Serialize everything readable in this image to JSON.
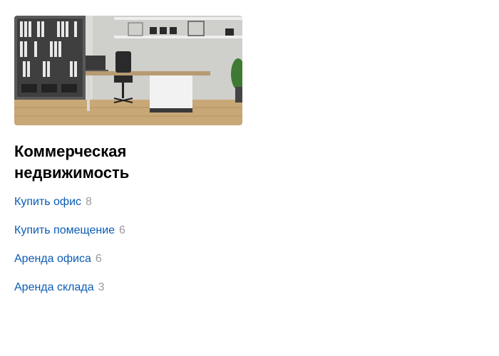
{
  "card": {
    "title": "Коммерческая недвижимость",
    "links": [
      {
        "label": "Купить офис",
        "count": "8"
      },
      {
        "label": "Купить помещение",
        "count": "6"
      },
      {
        "label": "Аренда офиса",
        "count": "6"
      },
      {
        "label": "Аренда склада",
        "count": "3"
      }
    ]
  },
  "colors": {
    "link": "#0a5bb5",
    "count": "#9b9b9b",
    "title": "#000000"
  }
}
